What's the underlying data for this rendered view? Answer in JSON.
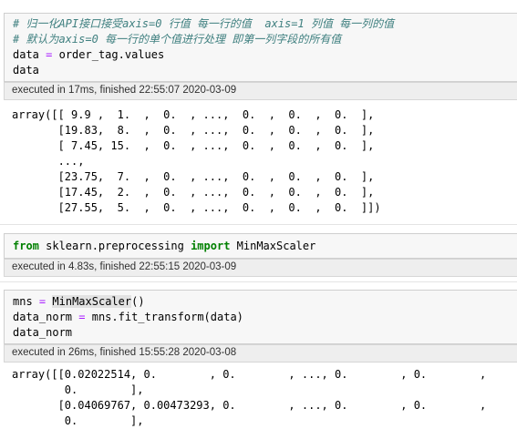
{
  "cell1": {
    "comment1": "# 归一化API接口接受axis=0 行值 每一行的值  axis=1 列值 每一列的值",
    "comment2": "# 默认为axis=0 每一行的单个值进行处理 即第一列字段的所有值",
    "line3_var": "data",
    "line3_op": "=",
    "line3_rhs": "order_tag.values",
    "line4": "data",
    "exec": "executed in 17ms, finished 22:55:07 2020-03-09",
    "output": [
      "array([[ 9.9 ,  1.  ,  0.  , ...,  0.  ,  0.  ,  0.  ],",
      "       [19.83,  8.  ,  0.  , ...,  0.  ,  0.  ,  0.  ],",
      "       [ 7.45, 15.  ,  0.  , ...,  0.  ,  0.  ,  0.  ],",
      "       ...,",
      "       [23.75,  7.  ,  0.  , ...,  0.  ,  0.  ,  0.  ],",
      "       [17.45,  2.  ,  0.  , ...,  0.  ,  0.  ,  0.  ],",
      "       [27.55,  5.  ,  0.  , ...,  0.  ,  0.  ,  0.  ]])"
    ]
  },
  "cell2": {
    "kw_from": "from",
    "module": " sklearn.preprocessing ",
    "kw_import": "import",
    "name": " MinMaxScaler",
    "exec": "executed in 4.83s, finished 22:55:15 2020-03-09"
  },
  "cell3": {
    "l1_var": "mns",
    "l1_op": "=",
    "l1_call": "MinMaxScaler",
    "l1_paren": "()",
    "l2_var": "data_norm",
    "l2_op": "=",
    "l2_rhs": "mns.fit_transform(data)",
    "l3": "data_norm",
    "exec": "executed in 26ms, finished 15:55:28 2020-03-08",
    "output": [
      "array([[0.02022514, 0.        , 0.        , ..., 0.        , 0.        ,",
      "        0.        ],",
      "       [0.04069767, 0.00473293, 0.        , ..., 0.        , 0.        ,",
      "        0.        ],"
    ]
  }
}
